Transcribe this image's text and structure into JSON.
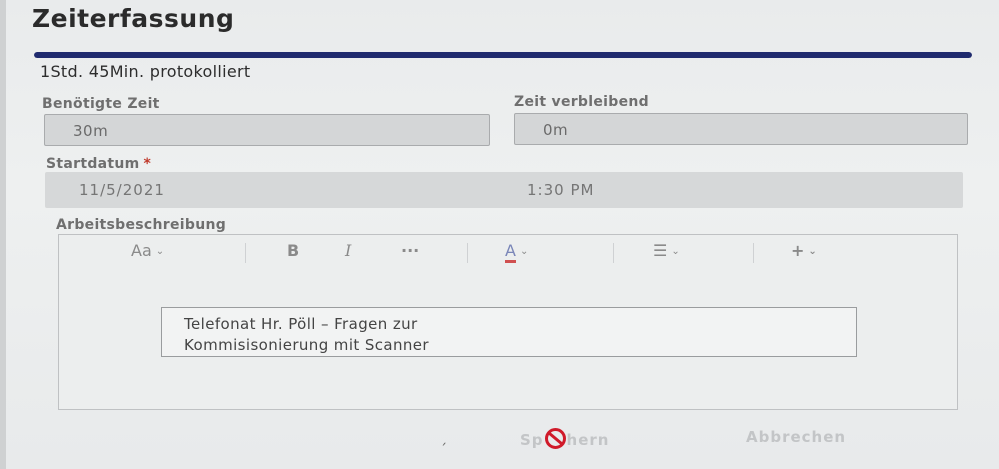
{
  "dialog": {
    "title": "Zeiterfassung",
    "progress_fraction": 1.0,
    "logged_text": "1Std. 45Min. protokolliert"
  },
  "fields": {
    "required_time_label": "Benötigte Zeit",
    "required_time_value": "30m",
    "remaining_time_label": "Zeit verbleibend",
    "remaining_time_value": "0m",
    "start_date_label": "Startdatum",
    "required_marker": "*",
    "start_date_value": "11/5/2021",
    "start_time_value": "1:30 PM"
  },
  "editor": {
    "label": "Arbeitsbeschreibung",
    "toolbar": {
      "font_size": "Aa",
      "bold": "B",
      "italic": "I",
      "more": "···",
      "font_color": "A",
      "list": "☰",
      "insert": "+",
      "chevron": "⌄"
    },
    "text_line1": "Telefonat Hr. Pöll – Fragen zur",
    "text_line2": "Kommisisonierung mit Scanner"
  },
  "footer": {
    "save_label_start": "Sp",
    "save_label_end": "hern",
    "cancel_label": "Abbrechen",
    "tick_glyph": "ˏ"
  },
  "colors": {
    "progress": "#1f2a6e",
    "required": "#c0392b",
    "blocked_icon": "#d01a2a"
  }
}
